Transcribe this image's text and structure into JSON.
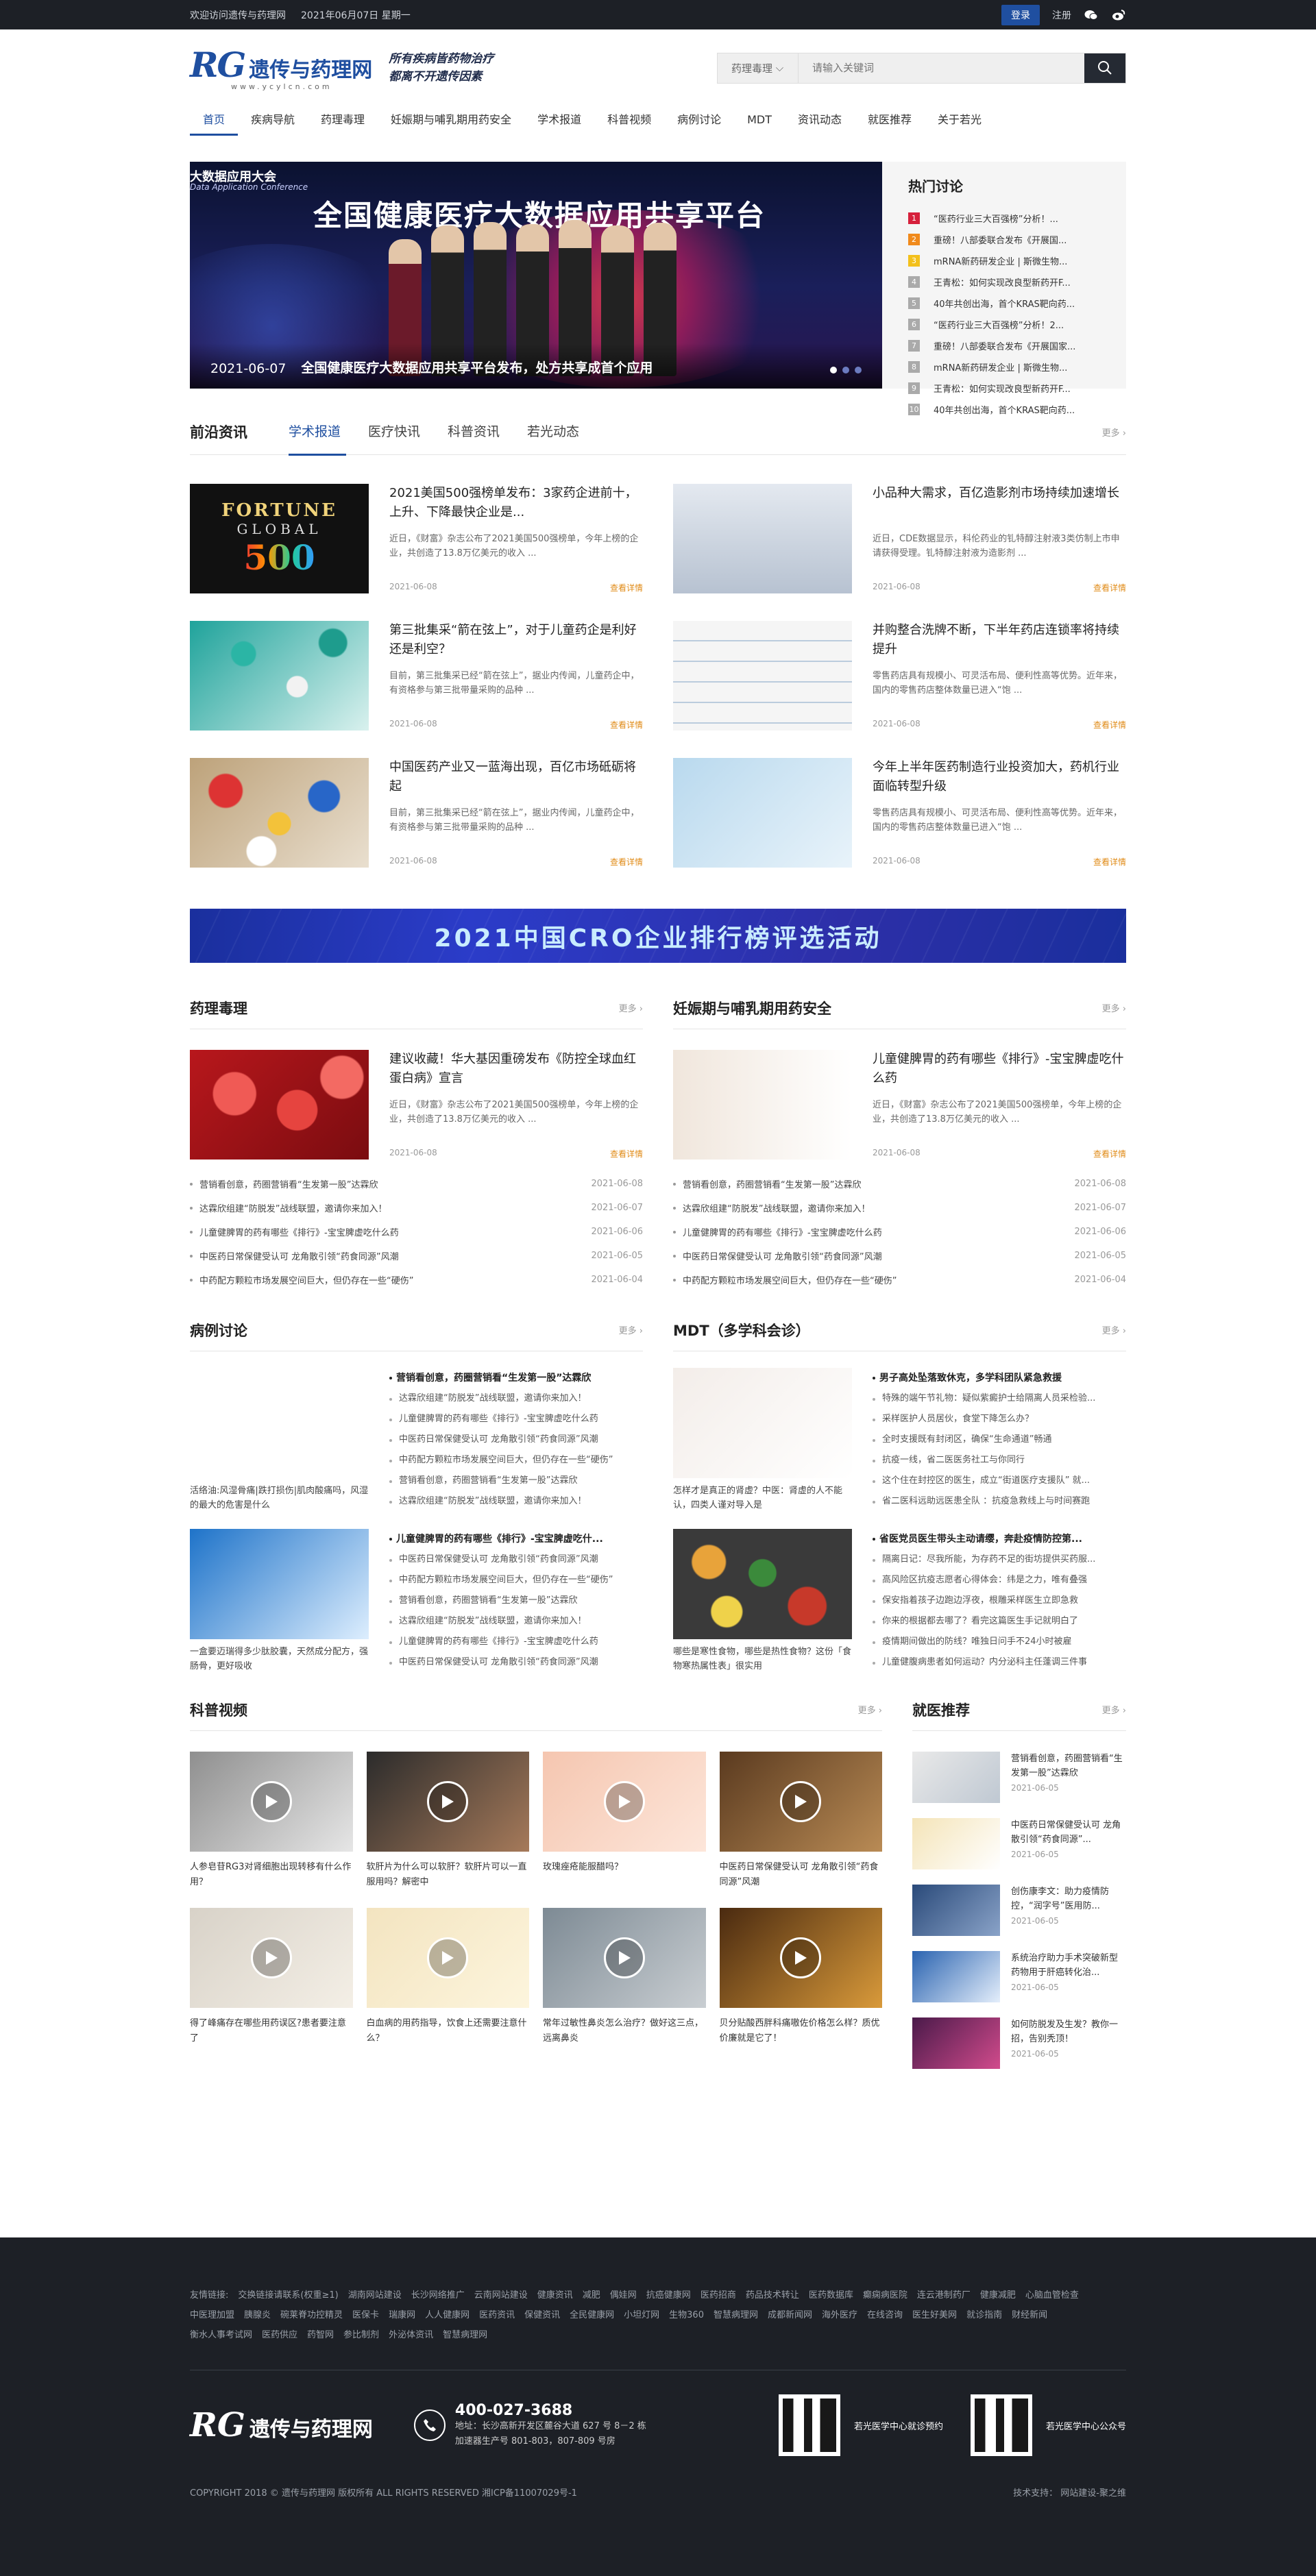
{
  "topbar": {
    "welcome": "欢迎访问遗传与药理网",
    "date": "2021年06月07日 星期一",
    "login": "登录",
    "register": "注册"
  },
  "header": {
    "logo_rg": "RG",
    "logo_cn": "遗传与药理网",
    "logo_url": "www.ycylcn.com",
    "slogan_1": "所有疾病皆药物治疗",
    "slogan_2": "都离不开遗传因素",
    "search_select": "药理毒理",
    "search_placeholder": "请输入关键词"
  },
  "nav": [
    "首页",
    "疾病导航",
    "药理毒理",
    "妊娠期与哺乳期用药安全",
    "学术报道",
    "科普视频",
    "病例讨论",
    "MDT",
    "资讯动态",
    "就医推荐",
    "关于若光"
  ],
  "banner": {
    "tag": "大数据应用大会",
    "tag_en": "Data Application Conference",
    "big": "全国健康医疗大数据应用共享平台",
    "date": "2021-06-07",
    "title": "全国健康医疗大数据应用共享平台发布，处方共享成首个应用"
  },
  "hot": {
    "title": "热门讨论",
    "items": [
      {
        "n": "1",
        "t": "“医药行业三大百强榜”分析！..."
      },
      {
        "n": "2",
        "t": "重磅！八部委联合发布《开展国..."
      },
      {
        "n": "3",
        "t": "mRNA新药研发企业 | 斯微生物..."
      },
      {
        "n": "4",
        "t": "王青松：如何实现改良型新药开F..."
      },
      {
        "n": "5",
        "t": "40年共创出海，首个KRAS靶向药..."
      },
      {
        "n": "6",
        "t": "“医药行业三大百强榜”分析！2..."
      },
      {
        "n": "7",
        "t": "重磅！八部委联合发布《开展国家..."
      },
      {
        "n": "8",
        "t": "mRNA新药研发企业 | 斯微生物..."
      },
      {
        "n": "9",
        "t": "王青松：如何实现改良型新药开F..."
      },
      {
        "n": "10",
        "t": "40年共创出海，首个KRAS靶向药..."
      }
    ]
  },
  "frontier": {
    "title": "前沿资讯",
    "tabs": [
      "学术报道",
      "医疗快讯",
      "科普资讯",
      "若光动态"
    ],
    "more": "更多 ›",
    "items": [
      {
        "t": "2021美国500强榜单发布：3家药企进前十，上升、下降最快企业是...",
        "s": "近日，《财富》杂志公布了2021美国500强榜单，今年上榜的企业，共创造了13.8万亿美元的收入 ...",
        "d": "2021-06-08",
        "go": "查看详情"
      },
      {
        "t": "小品种大需求，百亿造影剂市场持续加速增长",
        "s": "近日，CDE数据显示，科伦药业的钆特醇注射液3类仿制上市申请获得受理。钆特醇注射液为造影剂 ...",
        "d": "2021-06-08",
        "go": "查看详情"
      },
      {
        "t": "第三批集采“箭在弦上”，对于儿童药企是利好还是利空？",
        "s": "目前，第三批集采已经“箭在弦上”，据业内传闻，儿童药企中，有资格参与第三批带量采购的品种 ...",
        "d": "2021-06-08",
        "go": "查看详情"
      },
      {
        "t": "并购整合洗牌不断，下半年药店连锁率将持续提升",
        "s": "零售药店具有规模小、可灵活布局、便利性高等优势。近年来，国内的零售药店整体数量已进入“饱 ...",
        "d": "2021-06-08",
        "go": "查看详情"
      },
      {
        "t": "中国医药产业又一蓝海出现，百亿市场砥砺将起",
        "s": "目前，第三批集采已经“箭在弦上”，据业内传闻，儿童药企中，有资格参与第三批带量采购的品种 ...",
        "d": "2021-06-08",
        "go": "查看详情"
      },
      {
        "t": "今年上半年医药制造行业投资加大，药机行业面临转型升级",
        "s": "零售药店具有规模小、可灵活布局、便利性高等优势。近年来，国内的零售药店整体数量已进入“饱 ...",
        "d": "2021-06-08",
        "go": "查看详情"
      }
    ]
  },
  "fortune": {
    "l1": "FORTUNE",
    "l2": "GLOBAL",
    "l3": "500"
  },
  "cro": "2021中国CRO企业排行榜评选活动",
  "pharm": {
    "title": "药理毒理",
    "more": "更多 ›",
    "feature": {
      "t": "建议收藏！华大基因重磅发布《防控全球血红蛋白病》宣言",
      "s": "近日，《财富》杂志公布了2021美国500强榜单，今年上榜的企业，共创造了13.8万亿美元的收入 ...",
      "d": "2021-06-08",
      "go": "查看详情"
    },
    "list": [
      {
        "t": "营销看创意，药圈营销看“生发第一股”达霖欣",
        "d": "2021-06-08"
      },
      {
        "t": "达霖欣组建“防脱发”战线联盟，邀请你来加入！",
        "d": "2021-06-07"
      },
      {
        "t": "儿童健脾胃的药有哪些《排行》-宝宝脾虚吃什么药",
        "d": "2021-06-06"
      },
      {
        "t": "中医药日常保健受认可 龙角散引领“药食同源”风潮",
        "d": "2021-06-05"
      },
      {
        "t": "中药配方颗粒市场发展空间巨大，但仍存在一些“硬伤”",
        "d": "2021-06-04"
      }
    ]
  },
  "preg": {
    "title": "妊娠期与哺乳期用药安全",
    "more": "更多 ›",
    "feature": {
      "t": "儿童健脾胃的药有哪些《排行》-宝宝脾虚吃什么药",
      "s": "近日，《财富》杂志公布了2021美国500强榜单，今年上榜的企业，共创造了13.8万亿美元的收入 ...",
      "d": "2021-06-08",
      "go": "查看详情"
    },
    "list": [
      {
        "t": "营销看创意，药圈营销看“生发第一股”达霖欣",
        "d": "2021-06-08"
      },
      {
        "t": "达霖欣组建“防脱发”战线联盟，邀请你来加入！",
        "d": "2021-06-07"
      },
      {
        "t": "儿童健脾胃的药有哪些《排行》-宝宝脾虚吃什么药",
        "d": "2021-06-06"
      },
      {
        "t": "中医药日常保健受认可 龙角散引领“药食同源”风潮",
        "d": "2021-06-05"
      },
      {
        "t": "中药配方颗粒市场发展空间巨大，但仍存在一些“硬伤”",
        "d": "2021-06-04"
      }
    ]
  },
  "cases": {
    "title": "病例讨论",
    "more": "更多 ›",
    "blocks": [
      {
        "cap": "活络油:风湿骨痛|跌打损伤|肌肉酸痛吗，风湿的最大的危害是什么",
        "h": "营销看创意，药圈营销看“生发第一股”达霖欣",
        "items": [
          "达霖欣组建“防脱发”战线联盟，邀请你来加入！",
          "儿童健脾胃的药有哪些《排行》-宝宝脾虚吃什么药",
          "中医药日常保健受认可 龙角散引领“药食同源”风潮",
          "中药配方颗粒市场发展空间巨大，但仍存在一些“硬伤”",
          "营销看创意，药圈营销看“生发第一股”达霖欣",
          "达霖欣组建“防脱发”战线联盟，邀请你来加入！"
        ]
      },
      {
        "cap": "一盒要迈瑞得多少肽胶囊，天然成分配方，强肠骨，更好吸收",
        "h": "儿童健脾胃的药有哪些《排行》-宝宝脾虚吃什...",
        "items": [
          "中医药日常保健受认可 龙角散引领“药食同源”风潮",
          "中药配方颗粒市场发展空间巨大，但仍存在一些“硬伤”",
          "营销看创意，药圈营销看“生发第一股”达霖欣",
          "达霖欣组建“防脱发”战线联盟，邀请你来加入！",
          "儿童健脾胃的药有哪些《排行》-宝宝脾虚吃什么药",
          "中医药日常保健受认可 龙角散引领“药食同源”风潮"
        ]
      }
    ]
  },
  "mdt": {
    "title": "MDT（多学科会诊）",
    "more": "更多 ›",
    "blocks": [
      {
        "cap": "怎样才是真正的肾虚？中医：肾虚的人不能认，四类人谨对导入是",
        "h": "男子高处坠落致休克，多学科团队紧急救援",
        "items": [
          "特殊的端午节礼物：疑似紫癜护士给隔离人员采检验...",
          "采样医护人员居伙，食堂下降怎么办？",
          "全时支援既有封闭区，确保“生命通道”畅通",
          "抗疫一线，省二医医务社工与你同行",
          "这个住在封控区的医生，成立“街道医疗支援队” 就...",
          "省二医科远助远医患全队 ：抗疫急救线上与时间赛跑"
        ]
      },
      {
        "cap": "哪些是寒性食物，哪些是热性食物？这份「食物寒热属性表」很实用",
        "h": "省医党员医生带头主动请缨，奔赴疫情防控第...",
        "items": [
          "隔离日记：尽我所能，为存药不足的街坊提供买药服...",
          "高风险区抗疫志愿者心得体会：纬是之力，唯有叠强",
          "保安指着孩子边跑边浮夜，根雕采样医生立即急救",
          "你来的根据都去哪了？看完这篇医生手记就明白了",
          "疫情期间做出的防线？唯独日问手不24小时被雇",
          "儿童健腹病患者如何运动？内分泌科主任蓬调三件事"
        ]
      }
    ]
  },
  "videos": {
    "title": "科普视频",
    "more": "更多 ›",
    "items": [
      "人参皂苷RG3对肾细胞出现转移有什么作用？",
      "软肝片为什么可以软肝？软肝片可以一直服用吗？解密中",
      "玫瑰痤疮能服醋吗？",
      "中医药日常保健受认可 龙角散引领“药食同源”风潮",
      "得了峰痛存在哪些用药误区?患者要注意了",
      "白血病的用药指导，饮食上还需要注意什么？",
      "常年过敏性鼻炎怎么治疗？做好这三点，远离鼻炎",
      "贝分贴酸西胖科痛嗷佐价格怎么样？质优价廉就是它了！"
    ]
  },
  "recommend": {
    "title": "就医推荐",
    "more": "更多 ›",
    "items": [
      {
        "t": "营销看创意，药圈营销看“生发第一股”达霖欣",
        "d": "2021-06-05"
      },
      {
        "t": "中医药日常保健受认可 龙角散引领“药食同源”...",
        "d": "2021-06-05"
      },
      {
        "t": "创伤康李文：助力疫情防控，“润字号”医用防...",
        "d": "2021-06-05"
      },
      {
        "t": "系统治疗助力手术突破新型药物用于肝癌转化治...",
        "d": "2021-06-05"
      },
      {
        "t": "如何防脱发及生发？教你一招，告别秃顶！",
        "d": "2021-06-05"
      }
    ]
  },
  "footer": {
    "links": [
      "友情链接:",
      "交换链接请联系(权重≥1)",
      "湖南网站建设",
      "长沙网络推广",
      "云南网站建设",
      "健康资讯",
      "减肥",
      "偶娃网",
      "抗癌健康网",
      "医药招商",
      "药品技术转让",
      "医药数据库",
      "癫痫病医院",
      "连云港制药厂",
      "健康减肥",
      "心脑血管检查",
      "中医理加盟",
      "胰腺炎",
      "碗莱脊功控精灵",
      "医保卡",
      "瑞康网",
      "人人健康网",
      "医药资讯",
      "保健资讯",
      "全民健康网",
      "小坦灯网",
      "生物360",
      "智慧病理网",
      "成都新闻网",
      "海外医疗",
      "在线咨询",
      "医生好美网",
      "就诊指南",
      "财经新闻",
      "衡水人事考试网",
      "医药供应",
      "药智网",
      "参比制剂",
      "外泌体资讯",
      "智慧病理网"
    ],
    "logo_rg": "RG",
    "logo_cn": "遗传与药理网",
    "phone": "400-027-3688",
    "addr1": "地址：长沙高新开发区麓谷大道 627 号 8－2 栋",
    "addr2": "加速器生产号 801-803，807-809 号房",
    "qr1": "若光医学中心就诊预约",
    "qr2": "若光医学中心公众号",
    "copyright": "COPYRIGHT 2018 © 遗传与药理网 版权所有    ALL RIGHTS RESERVED   湘ICP备11007029号-1",
    "support": "技术支持：  网站建设-聚之维"
  },
  "colors": {
    "brand": "#1f4fa0",
    "dark": "#1d2026",
    "accent": "#e08b17",
    "hot1": "#d6203b",
    "hot2": "#f08a1c",
    "hot3": "#f3c01b"
  }
}
